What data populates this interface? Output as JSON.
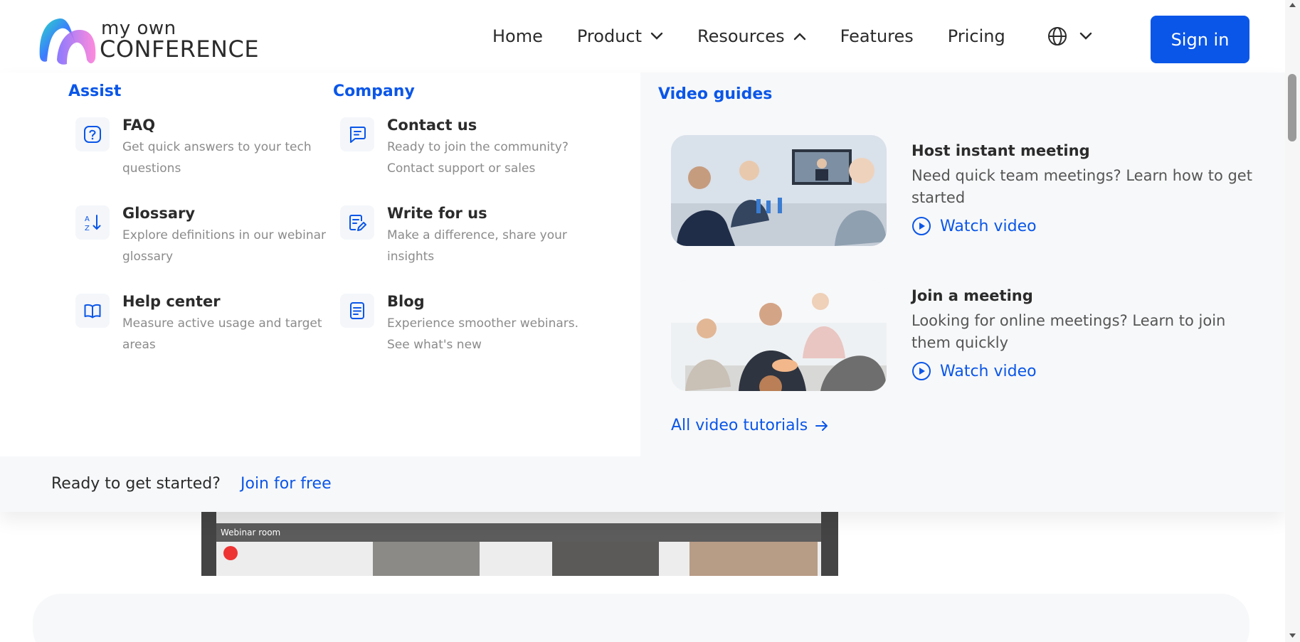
{
  "header": {
    "logo_line1": "my own",
    "logo_line2": "CONFERENCE",
    "nav": [
      "Home",
      "Product",
      "Resources",
      "Features",
      "Pricing"
    ],
    "sign_in": "Sign in"
  },
  "menu": {
    "assist": {
      "heading": "Assist",
      "items": [
        {
          "title": "FAQ",
          "desc": "Get quick answers to your tech questions",
          "icon": "question-icon"
        },
        {
          "title": "Glossary",
          "desc": "Explore definitions in our webinar glossary",
          "icon": "sort-az-icon"
        },
        {
          "title": "Help center",
          "desc": "Measure active usage and target areas",
          "icon": "book-icon"
        }
      ]
    },
    "company": {
      "heading": "Company",
      "items": [
        {
          "title": "Contact us",
          "desc": "Ready to join the community? Contact support or sales",
          "icon": "chat-icon"
        },
        {
          "title": "Write for us",
          "desc": "Make a difference, share your insights",
          "icon": "edit-doc-icon"
        },
        {
          "title": "Blog",
          "desc": "Experience smoother webinars. See what's new",
          "icon": "document-icon"
        }
      ]
    },
    "video_guides": {
      "heading": "Video guides",
      "items": [
        {
          "title": "Host instant meeting",
          "desc": "Need quick team meetings? Learn how to get started",
          "action": "Watch video"
        },
        {
          "title": "Join a meeting",
          "desc": "Looking for online meetings? Learn to join them quickly",
          "action": "Watch video"
        }
      ],
      "all_link": "All video tutorials"
    },
    "cta": {
      "prompt": "Ready to get started?",
      "link": "Join for free"
    }
  },
  "background": {
    "room_label": "Webinar room"
  },
  "colors": {
    "accent": "#0a56e8",
    "panel": "#f7f8fa"
  }
}
